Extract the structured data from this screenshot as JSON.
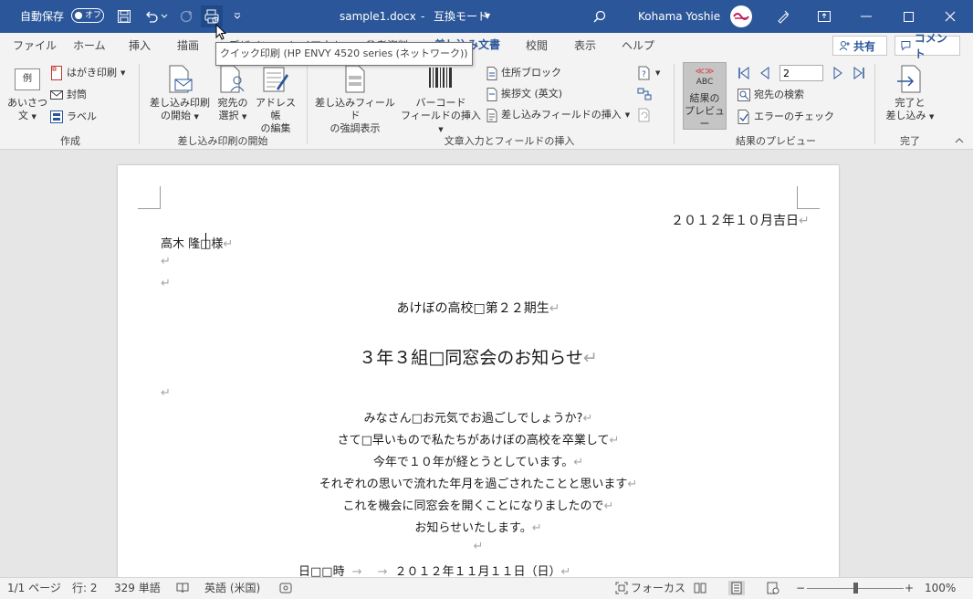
{
  "titlebar": {
    "autosave_label": "自動保存",
    "autosave_state": "オフ",
    "doc_title": "sample1.docx",
    "separator": "-",
    "mode": "互換モード",
    "user_name": "Kohama Yoshie"
  },
  "tabs": [
    "ファイル",
    "ホーム",
    "挿入",
    "描画",
    "デザイン",
    "レイアウト",
    "参考資料",
    "差し込み文書",
    "校閲",
    "表示",
    "ヘルプ"
  ],
  "active_tab": "差し込み文書",
  "share_label": "共有",
  "comment_label": "コメント",
  "tooltip": "クイック印刷 (HP ENVY 4520 series (ネットワーク))",
  "ribbon": {
    "create": {
      "label": "作成",
      "greeting": "あいさつ文",
      "greeting_line1": "あいさつ",
      "greeting_line2": "文",
      "greeting_icon_text": "例",
      "postcard": "はがき印刷",
      "envelope": "封筒",
      "labels": "ラベル"
    },
    "start": {
      "label": "差し込み印刷の開始",
      "start_line1": "差し込み印刷",
      "start_line2": "の開始",
      "select_line1": "宛先の",
      "select_line2": "選択",
      "edit_line1": "アドレス帳",
      "edit_line2": "の編集"
    },
    "write": {
      "label": "文章入力とフィールドの挿入",
      "highlight_line1": "差し込みフィールド",
      "highlight_line2": "の強調表示",
      "barcode_line1": "バーコード",
      "barcode_line2": "フィールドの挿入",
      "address_block": "住所ブロック",
      "greeting_line": "挨拶文 (英文)",
      "insert_field": "差し込みフィールドの挿入"
    },
    "preview": {
      "label": "結果のプレビュー",
      "btn_line1": "結果の",
      "btn_line2": "プレビュー",
      "abc": "ABC",
      "record": "2",
      "find": "宛先の検索",
      "check": "エラーのチェック"
    },
    "finish": {
      "label": "完了",
      "line1": "完了と",
      "line2": "差し込み"
    }
  },
  "document": {
    "date": "２０１２年１０月吉日",
    "addressee": "高木 隆□様",
    "org": "あけぼの高校□第２２期生",
    "title": "３年３組□同窓会のお知らせ",
    "body": [
      "みなさん□お元気でお過ごしでしょうか?",
      "さて□早いもので私たちがあけぼの高校を卒業して",
      "今年で１０年が経とうとしています。",
      "それぞれの思いで流れた年月を過ごされたことと思います",
      "これを機会に同窓会を開くことになりましたので",
      "お知らせいたします。"
    ],
    "datetime_label": "日□□時",
    "datetime_tabs": "→　 →",
    "datetime_value": "２０１２年１１月１１日（日）",
    "para_mark": "↵"
  },
  "status": {
    "page": "1/1 ページ",
    "line": "行: 2",
    "words": "329 単語",
    "language": "英語 (米国)",
    "focus": "フォーカス",
    "zoom_minus": "−",
    "zoom_plus": "+",
    "zoom": "100%",
    "zoom_fraction": 0.5
  },
  "colors": {
    "titlebar": "#2b579a",
    "accent": "#2b579a",
    "ribbon_bg": "#f3f3f3",
    "workspace": "#e6e6e6",
    "preview_active": "#c5c5c5"
  }
}
